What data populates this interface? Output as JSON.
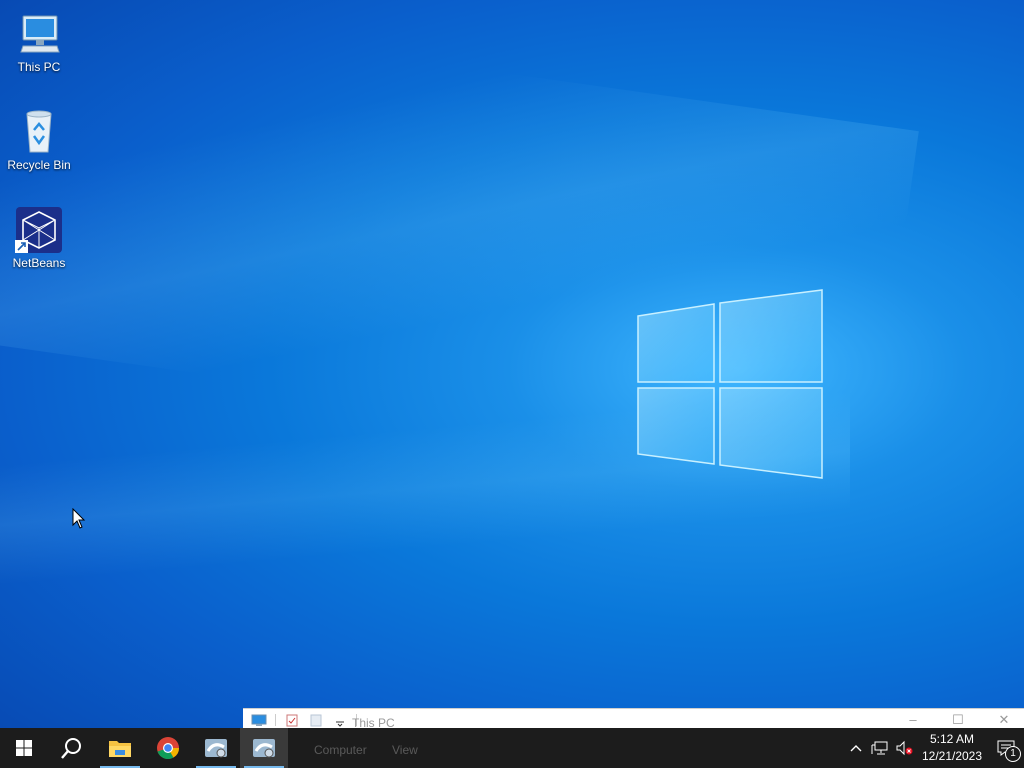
{
  "desktop": {
    "icons": [
      {
        "label": "This PC"
      },
      {
        "label": "Recycle Bin"
      },
      {
        "label": "NetBeans"
      }
    ]
  },
  "explorer_window": {
    "title": "This PC",
    "ribbon_tabs": [
      "Computer",
      "View"
    ]
  },
  "taskbar": {
    "buttons": [
      "start",
      "search",
      "file-explorer",
      "chrome",
      "netbeans-app",
      "netbeans-app-2"
    ]
  },
  "tray": {
    "time": "5:12 AM",
    "date": "12/21/2023",
    "notification_count": "1"
  },
  "colors": {
    "taskbar_bg": "#1c1c1c",
    "accent": "#76b9ed",
    "wallpaper": "#0a78da"
  }
}
